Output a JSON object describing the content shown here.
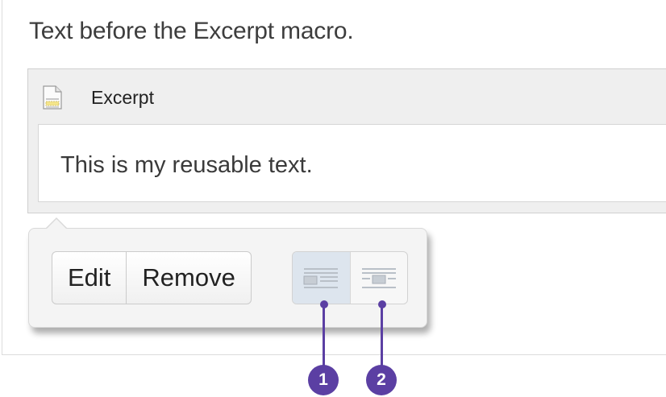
{
  "editor": {
    "intro_text": "Text before the Excerpt macro."
  },
  "macro": {
    "title": "Excerpt",
    "icon": "page-icon",
    "body_text": "This is my reusable text."
  },
  "popup": {
    "edit_label": "Edit",
    "remove_label": "Remove",
    "align_left_icon": "align-left-icon",
    "align_center_icon": "align-center-icon"
  },
  "callouts": [
    "1",
    "2"
  ],
  "colors": {
    "callout": "#5b3fa3",
    "active_align": "#dde5ee"
  }
}
